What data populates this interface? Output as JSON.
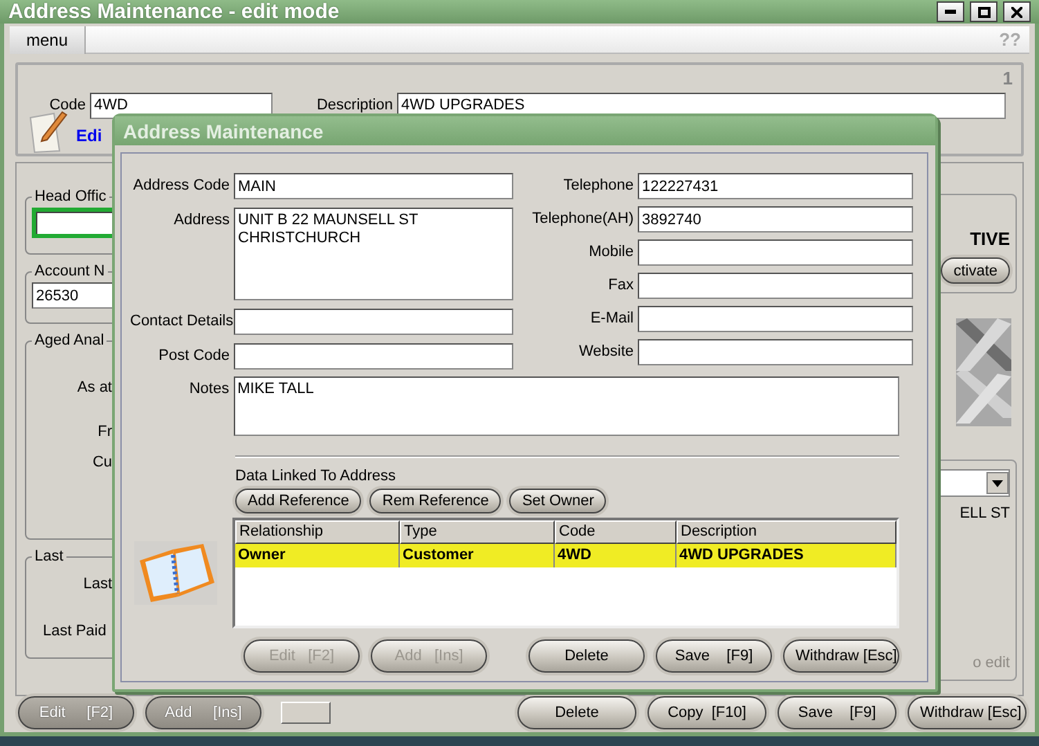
{
  "window": {
    "title": "Address Maintenance - edit mode"
  },
  "menu": {
    "items": [
      {
        "label": "menu"
      }
    ],
    "help": "??"
  },
  "header": {
    "page": "1",
    "code_label": "Code",
    "code_value": "4WD",
    "description_label": "Description",
    "description_value": "4WD UPGRADES",
    "mode": "Edi"
  },
  "left_groups": [
    {
      "kind": "input",
      "legend": "Head Offic",
      "focused": true
    },
    {
      "kind": "input",
      "legend": "Account N",
      "value": "26530",
      "focused": false
    },
    {
      "kind": "labels",
      "legend": "Aged Anal",
      "labels": [
        "As at",
        "Fr",
        "Cu"
      ]
    },
    {
      "kind": "labels",
      "legend": "Last",
      "labels": [
        "Last",
        "Last Paid"
      ]
    }
  ],
  "right_panel": {
    "status": "TIVE",
    "button": "ctivate",
    "address_line": "ELL ST",
    "hint": "o edit"
  },
  "footer": {
    "left_buttons": [
      {
        "label": "Edit     [F2]",
        "disabled": true
      },
      {
        "label": "Add     [Ins]",
        "disabled": true
      }
    ],
    "right_buttons": [
      {
        "label": "Delete",
        "disabled": false
      },
      {
        "label": "Copy  [F10]",
        "disabled": false
      },
      {
        "label": "Save    [F9]",
        "disabled": false
      },
      {
        "label": "Withdraw [Esc]",
        "disabled": false
      }
    ]
  },
  "dialog": {
    "title": "Address Maintenance",
    "left_fields": [
      {
        "label": "Address Code",
        "value": "MAIN",
        "kind": "line"
      },
      {
        "label": "Address",
        "value": "UNIT B 22 MAUNSELL ST\nCHRISTCHURCH",
        "kind": "area"
      },
      {
        "label": "Contact Details",
        "kind": "line"
      },
      {
        "label": "Post Code",
        "kind": "line"
      }
    ],
    "right_fields": [
      {
        "label": "Telephone",
        "value": "122227431"
      },
      {
        "label": "Telephone(AH)",
        "value": "3892740"
      },
      {
        "label": "Mobile"
      },
      {
        "label": "Fax"
      },
      {
        "label": "E-Mail"
      },
      {
        "label": "Website"
      }
    ],
    "notes": {
      "label": "Notes",
      "value": "MIKE TALL"
    },
    "linked_title": "Data Linked To Address",
    "link_buttons": [
      "Add Reference",
      "Rem Reference",
      "Set Owner"
    ],
    "table": {
      "columns": [
        "Relationship",
        "Type",
        "Code",
        "Description"
      ],
      "rows": [
        {
          "cells": [
            "Owner",
            "Customer",
            "4WD",
            "4WD UPGRADES"
          ],
          "selected": true
        }
      ]
    },
    "left_buttons": [
      {
        "label": "Edit   [F2]",
        "disabled": true
      },
      {
        "label": "Add   [Ins]",
        "disabled": true
      }
    ],
    "right_buttons": [
      {
        "label": "Delete",
        "disabled": false
      },
      {
        "label": "Save    [F9]",
        "disabled": false
      },
      {
        "label": "Withdraw [Esc]",
        "disabled": false
      }
    ]
  }
}
